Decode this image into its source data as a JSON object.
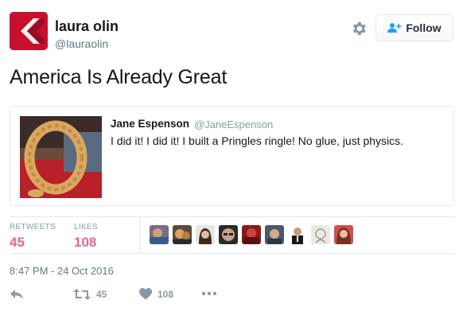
{
  "user": {
    "name": "laura olin",
    "handle": "@lauraolin"
  },
  "follow_label": "Follow",
  "tweet_text": "America Is Already Great",
  "quote": {
    "name": "Jane Espenson",
    "handle": "@JaneEspenson",
    "text": "I did it!  I did it!  I built a Pringles ringle!  No glue, just physics."
  },
  "stats": {
    "retweets_label": "RETWEETS",
    "retweets_value": "45",
    "likes_label": "LIKES",
    "likes_value": "108"
  },
  "likers_count": 9,
  "timestamp": "8:47 PM - 24 Oct 2016",
  "actions": {
    "retweet_count": "45",
    "like_count": "108"
  },
  "colors": {
    "accent": "#1da1f2",
    "like": "#e0245e",
    "muted": "#8899a6",
    "avatar": "#c8102e"
  },
  "icons": [
    "gear-icon",
    "follow-person-icon",
    "reply-icon",
    "retweet-icon",
    "heart-icon",
    "more-icon"
  ]
}
